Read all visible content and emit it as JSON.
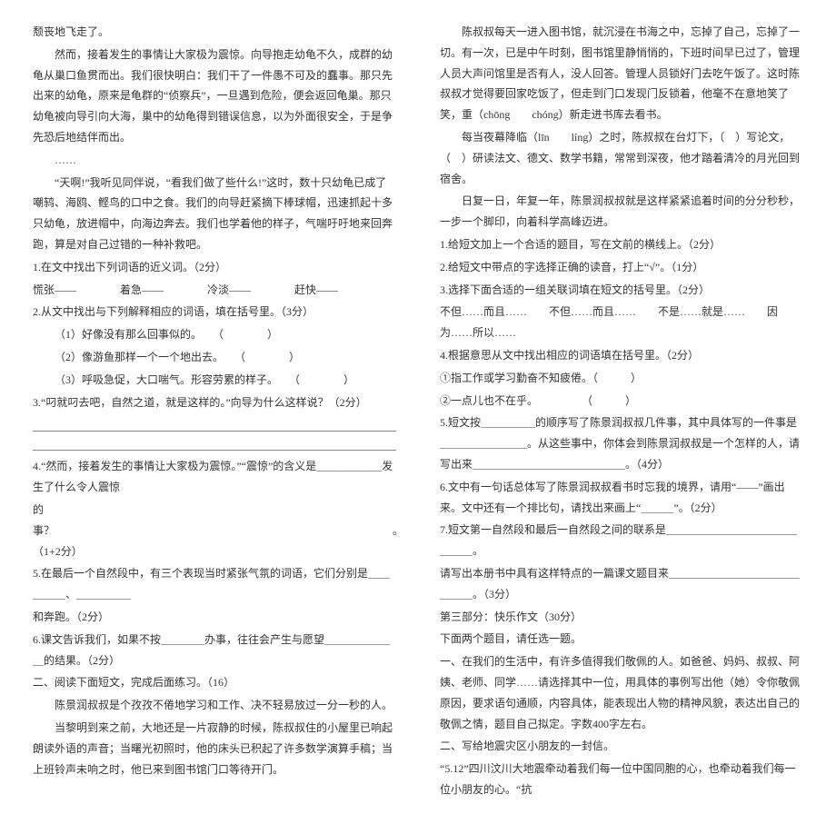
{
  "left": {
    "p1": "颓丧地飞走了。",
    "p2": "然而，接着发生的事情让大家极为震惊。向导抱走幼龟不久，成群的幼龟从巢口鱼贯而出。我们很快明白：我们干了一件愚不可及的蠢事。那只先出来的幼龟，原来是龟群的“侦察兵”，一旦遇到危险，便会返回龟巢。那只幼龟被向导引向大海，巢中的幼龟得到错误信息，以为外面很安全，于是争先恐后地结伴而出。",
    "p3": "……",
    "p4": "“天啊!”我听见同伴说，“看我们做了些什么!”这时，数十只幼龟已成了嘲鸫、海鸥、鲣鸟的口中之食。我们的向导赶紧摘下棒球帽，迅速抓起十多只幼龟，放进帽中，向海边奔去。我们也学着他的样子，气喘吁吁地来回奔跑，算是对自己过错的一种补救吧。",
    "q1": "1.在文中找出下列词语的近义词。（2分）",
    "q1_line": "慌张——　　　　着急——　　　　冷淡——　　　　赶快——",
    "q2": "2.从文中找出与下列解释相应的词语，填在括号里。（3分）",
    "q2a": "（1）好像没有那么回事似的。　　（　　　　）",
    "q2b": "（2）像游鱼那样一个一个地出去。　　（　　　　）",
    "q2c": "（3）呼吸急促，大口喘气。形容劳累的样子。　　（　　　　）",
    "q3": "3.“叼就叼去吧，自然之道，就是这样的。”向导为什么这样说？（2分）",
    "q4a": "4.“然而，接着发生的事情让大家极为震惊。”“震惊”的含义是＿＿＿＿＿＿发生了什么令人震惊",
    "q4b": "的事？　　　　　　　　　　　　　　　　　　　　　　　　　　　　　　　。（1+2分）",
    "q5a": "5.在最后一个自然段中，有三个表现当时紧张气氛的词语，它们分别是＿＿＿＿＿、＿＿＿＿＿",
    "q5b": "和奔跑。（2分）",
    "q6": "6.课文告诉我们，如果不按＿＿＿＿办事，往往会产生与愿望＿＿＿＿＿＿＿的结果。（2分）",
    "q7": "二、阅读下面短文，完成后面练习。（16）",
    "pA": "陈景润叔叔是个孜孜不倦地学习和工作、决不轻易放过一分一秒的人。",
    "pB": "当黎明到来之前，大地还是一片寂静的时候，陈叔叔住的小屋里已响起朗读外语的声音；当曙光初照时，他的床头已积起了许多数学演算手稿；当上班铃声未响之时，他已来到图书馆门口等待开门。"
  },
  "right": {
    "pC": "陈叔叔每天一进入图书馆，就沉浸在书海之中，忘掉了自己，忘掉了一切。有一次，已是中午时刻，图书馆里静悄悄的，下班时间早已过了，管理人员大声问馆里是否有人，没人回答。管理人员锁好门去吃午饭了。这时陈叔叔才觉得要回家吃饭了，但走到门口发现门反锁着，他毫不在意地笑了笑，重（chōng　　chóng）新走进书库去看书。",
    "pD": "每当夜幕降临（līn　　líng）之时，陈叔叔在台灯下，（　）写论文，（　）研读法文、德文、数学书籍，常常到深夜，他才踏着清冷的月光回到宿舍。",
    "pE": "日复一日，年复一年，陈景润叔叔就是这样紧紧追着时间的分分秒秒，一步一个脚印，向着科学高峰迈进。",
    "r1": "1.给短文加上一个合适的题目，写在文前的横线上。（2分）",
    "r2": "2.给短文中带点的字选择正确的读音，打上“√”。（1分）",
    "r3a": "3.选择下面合适的一组关联词填在短文的括号里。（2分）",
    "r3b": "不但……而且……　　不但……而且……　　不是……就是……　　因为……所以……",
    "r4": "4.根据意思从文中找出相应的词语填在括号里。（2分）",
    "r4a": "①指工作或学习勤奋不知疲倦。（　　　）",
    "r4b": "②一点儿也不在乎。　　　　　（　　　）",
    "r5": "5.短文按＿＿＿＿＿的顺序写了陈景润叔叔几件事，其中具体写的一件事是＿＿＿＿＿＿＿＿。从这些事中，你体会到陈景润叔叔是一个怎样的人，请写出来＿＿＿＿＿＿＿＿＿＿＿＿＿＿。（4分）",
    "r6": "6.文中有一句话总体写了陈景润叔叔看书时忘我的境界，请用“——”画出来。文中还有一个排比句，请找出来画上“＿＿＿”。（2分）",
    "r7a": "7.短文第一自然段和最后一自然段之间的联系是＿＿＿＿＿＿＿＿＿＿＿＿＿＿＿。",
    "r7b": "请写出本册书中具有这样特点的一篇课文题目来＿＿＿＿＿＿＿＿＿＿＿＿＿＿＿。（3分）",
    "section3": "第三部分：快乐作文（30分）",
    "s3a": "下面两个题目，请任选一题。",
    "s3b": "一、在我们的生活中，有许多值得我们敬佩的人。如爸爸、妈妈、叔叔、阿姨、老师、同学……请选择其中一位，用具体的事例写出他（她）令你敬佩原因，要求语句通顺，内容具体，能表现出人物的精神风貌，表达出自己的敬佩之情，题目自己拟定。字数400字左右。",
    "s3c": "二、写给地震灾区小朋友的一封信。",
    "s3d": "“5.12”四川汶川大地震牵动着我们每一位中国同胞的心，也牵动着我们每一位小朋友的心。“抗"
  }
}
